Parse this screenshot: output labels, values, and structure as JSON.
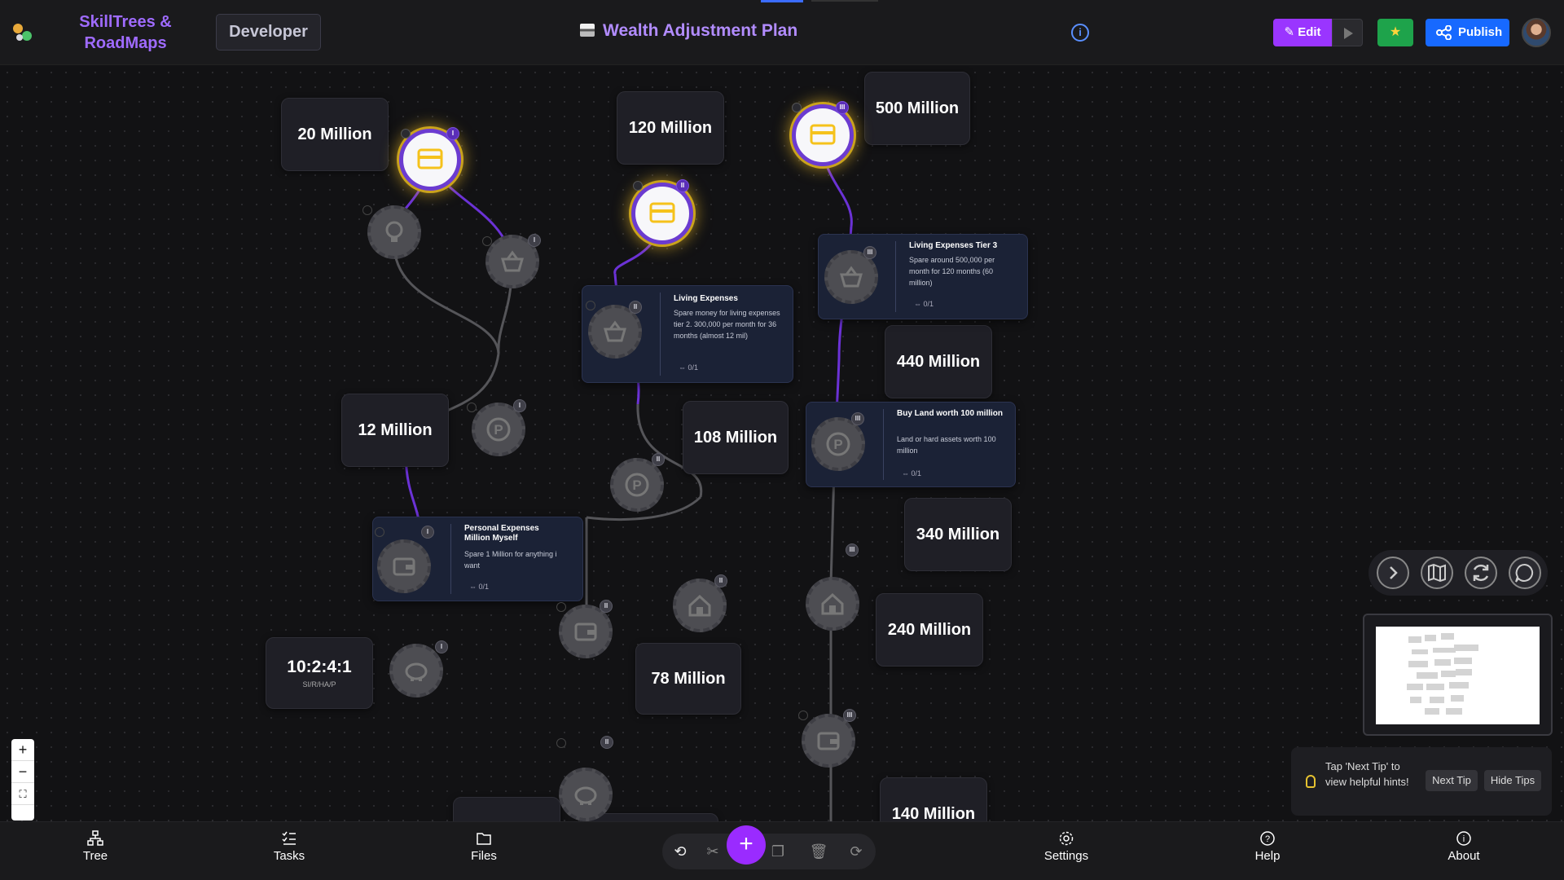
{
  "header": {
    "brand_line1": "SkillTrees &",
    "brand_line2": "RoadMaps",
    "developer_label": "Developer",
    "plan_title": "Wealth Adjustment Plan",
    "edit_label": "Edit",
    "publish_label": "Publish"
  },
  "labels": {
    "m20": "20 Million",
    "m120": "120 Million",
    "m500": "500 Million",
    "m12": "12 Million",
    "m440": "440 Million",
    "m108": "108 Million",
    "m340": "340 Million",
    "m240": "240 Million",
    "m78": "78 Million",
    "m140": "140 Million",
    "time_main": "10:2:4:1",
    "time_sub": "SI/R/HA/P"
  },
  "cards": {
    "living_exp": {
      "title": "Living Expenses",
      "desc": "Spare money for living expenses tier 2. 300,000 per month for 36 months (almost 12 mil)",
      "progress": "0/1"
    },
    "living_t3": {
      "title": "Living Expenses Tier 3",
      "desc": "Spare around 500,000 per month for 120 months (60 million)",
      "progress": "0/1"
    },
    "buy_land": {
      "title": "Buy Land worth 100 million",
      "desc": "Land or hard assets worth 100 million",
      "progress": "0/1"
    },
    "personal": {
      "title": "Personal Expenses Million Myself",
      "desc": "Spare 1 Million for anything i want",
      "progress": "0/1"
    }
  },
  "badges": {
    "one": "I",
    "two": "II",
    "three": "III"
  },
  "tips": {
    "text": "Tap 'Next Tip' to view helpful hints!",
    "next": "Next Tip",
    "hide": "Hide Tips"
  },
  "nav": {
    "tree": "Tree",
    "tasks": "Tasks",
    "files": "Files",
    "settings": "Settings",
    "help": "Help",
    "about": "About"
  },
  "icons": {
    "active_node": "credit-card-icon",
    "basket": "basket-icon",
    "parking": "parking-icon",
    "home": "home-icon",
    "wallet": "wallet-icon",
    "piggy": "piggy-bank-icon",
    "bulb": "lightbulb-icon"
  },
  "colors": {
    "accent": "#9a35ff",
    "link_active": "#6b32d6",
    "link_inactive": "#555559",
    "gold": "#caa31c",
    "publish": "#1769ff",
    "star": "#1ea34b"
  }
}
